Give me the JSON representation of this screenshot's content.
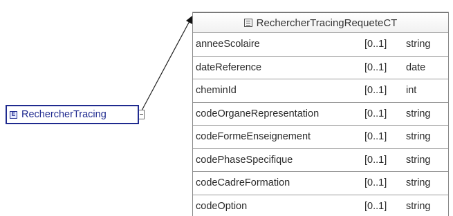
{
  "element": {
    "label": "RechercherTracing",
    "icon": "element-icon"
  },
  "type": {
    "title": "RechercherTracingRequeteCT",
    "icon": "complex-type-icon",
    "fields": [
      {
        "name": "anneeScolaire",
        "cardinality": "[0..1]",
        "type": "string"
      },
      {
        "name": "dateReference",
        "cardinality": "[0..1]",
        "type": "date"
      },
      {
        "name": "cheminId",
        "cardinality": "[0..1]",
        "type": "int"
      },
      {
        "name": "codeOrganeRepresentation",
        "cardinality": "[0..1]",
        "type": "string"
      },
      {
        "name": "codeFormeEnseignement",
        "cardinality": "[0..1]",
        "type": "string"
      },
      {
        "name": "codePhaseSpecifique",
        "cardinality": "[0..1]",
        "type": "string"
      },
      {
        "name": "codeCadreFormation",
        "cardinality": "[0..1]",
        "type": "string"
      },
      {
        "name": "codeOption",
        "cardinality": "[0..1]",
        "type": "string"
      }
    ]
  },
  "colors": {
    "element_border": "#1f2a8f",
    "table_border": "#8a8a8a"
  }
}
